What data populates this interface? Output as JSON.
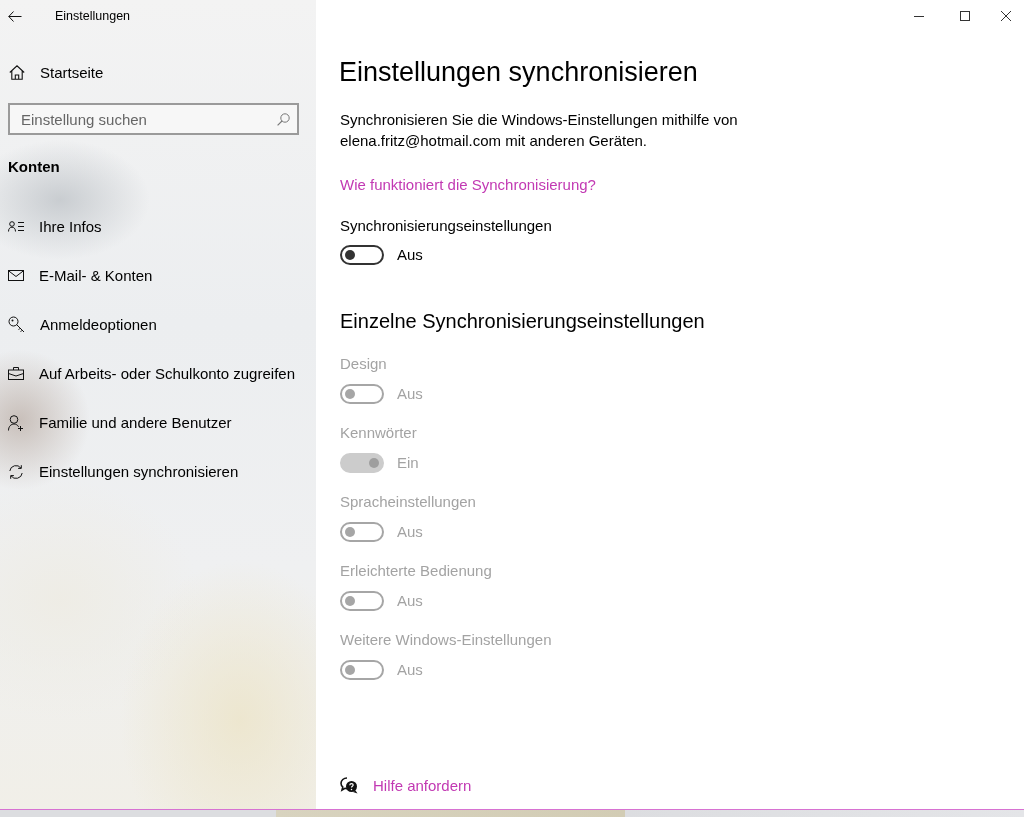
{
  "window": {
    "title": "Einstellungen"
  },
  "sidebar": {
    "home": "Startseite",
    "search": {
      "placeholder": "Einstellung suchen"
    },
    "section": "Konten",
    "items": [
      "Ihre Infos",
      "E-Mail- & Konten",
      "Anmeldeoptionen",
      "Auf Arbeits- oder Schulkonto zugreifen",
      "Familie und andere Benutzer",
      "Einstellungen synchronisieren"
    ]
  },
  "main": {
    "title": "Einstellungen synchronisieren",
    "description": "Synchronisieren Sie die Windows-Einstellungen mithilfe von elena.fritz@hotmail.com mit anderen Geräten.",
    "link": "Wie funktioniert die Synchronisierung?",
    "master": {
      "label": "Synchronisierungseinstellungen",
      "on": false,
      "state_text": "Aus"
    },
    "section_title": "Einzelne Synchronisierungseinstellungen",
    "toggles": [
      {
        "label": "Design",
        "on": false,
        "disabled": true,
        "state_text": "Aus"
      },
      {
        "label": "Kennwörter",
        "on": true,
        "disabled": true,
        "state_text": "Ein"
      },
      {
        "label": "Spracheinstellungen",
        "on": false,
        "disabled": true,
        "state_text": "Aus"
      },
      {
        "label": "Erleichterte Bedienung",
        "on": false,
        "disabled": true,
        "state_text": "Aus"
      },
      {
        "label": "Weitere Windows-Einstellungen",
        "on": false,
        "disabled": true,
        "state_text": "Aus"
      }
    ],
    "help": "Hilfe anfordern"
  }
}
